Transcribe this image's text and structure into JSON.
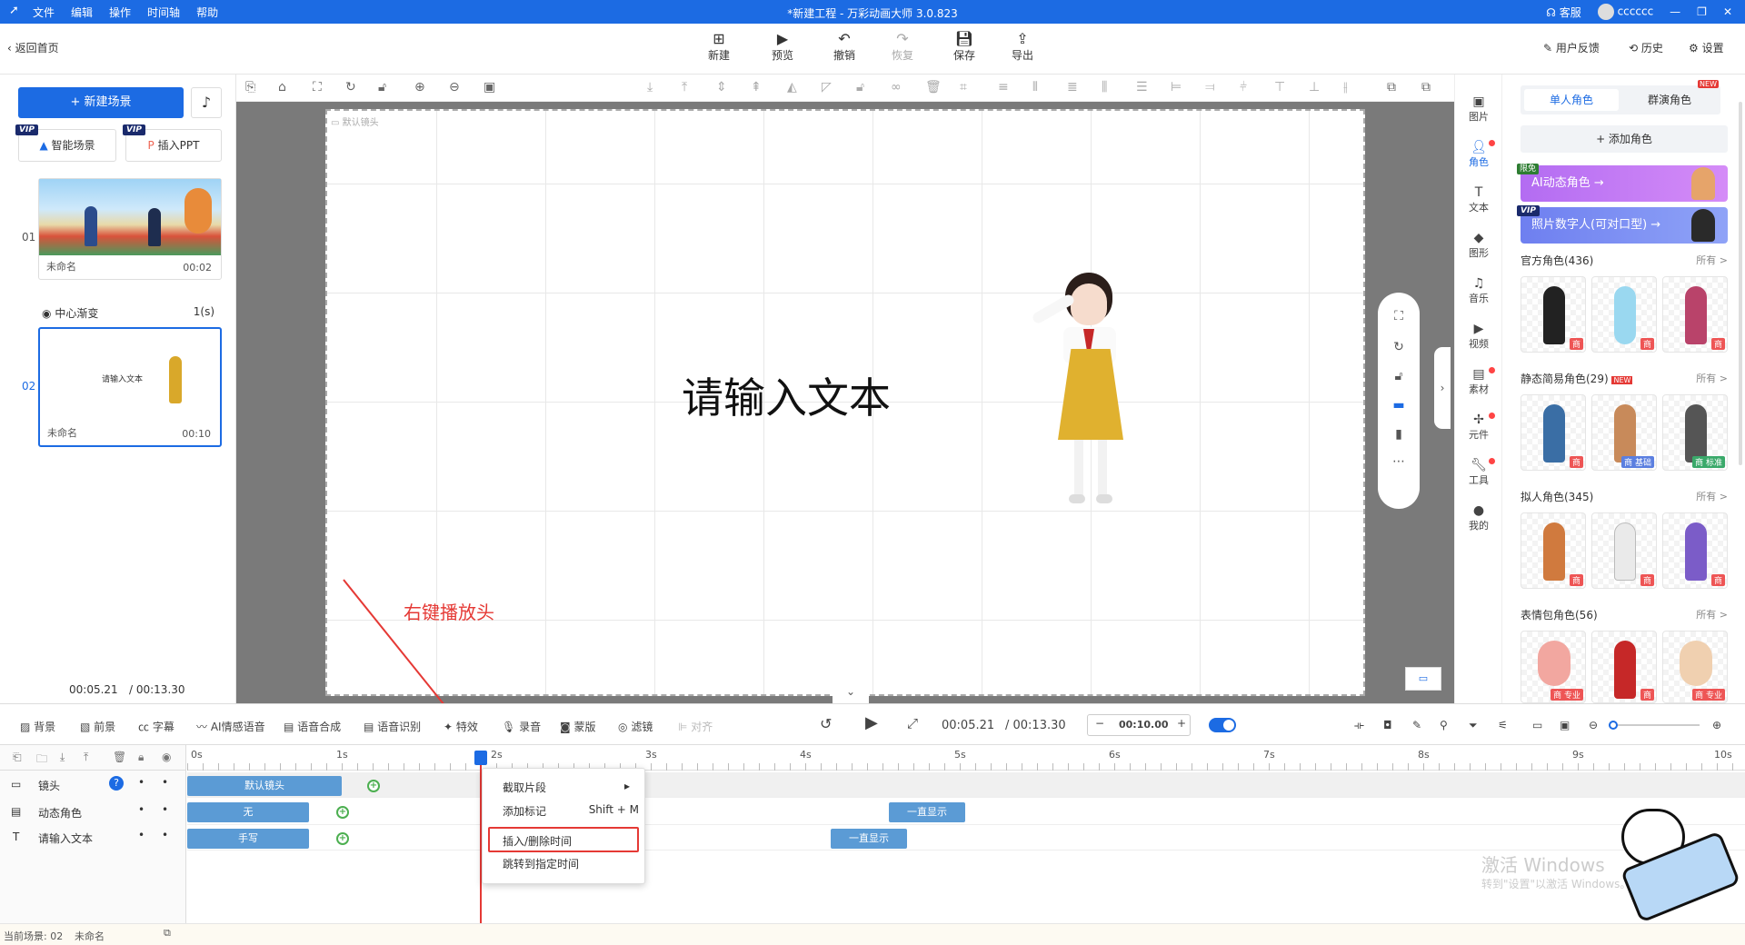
{
  "titlebar": {
    "menu": [
      "文件",
      "编辑",
      "操作",
      "时间轴",
      "帮助"
    ],
    "title": "*新建工程 - 万彩动画大师 3.0.823",
    "service": "客服",
    "user": "cccccc"
  },
  "toolbar": {
    "back": "返回首页",
    "buttons": [
      "新建",
      "预览",
      "撤销",
      "恢复",
      "保存",
      "导出"
    ],
    "feedback": "用户反馈",
    "history": "历史",
    "settings": "设置"
  },
  "left": {
    "new_scene": "+ 新建场景",
    "smart_scene": "智能场景",
    "insert_ppt": "插入PPT",
    "vip": "VIP",
    "scenes": [
      {
        "num": "01",
        "name": "未命名",
        "time": "00:02"
      },
      {
        "num": "02",
        "name": "未命名",
        "time": "00:10",
        "thumb_text": "请输入文本"
      }
    ],
    "transition": {
      "name": "中心渐变",
      "duration": "1(s)"
    },
    "time_current": "00:05.21",
    "time_total": "/ 00:13.30"
  },
  "canvas": {
    "camera_label": "默认镜头",
    "main_text": "请输入文本",
    "annotation": "右键播放头"
  },
  "sidestrip": [
    "图片",
    "角色",
    "文本",
    "图形",
    "音乐",
    "视频",
    "素材",
    "元件",
    "工具",
    "我的"
  ],
  "rightpanel": {
    "tab_single": "单人角色",
    "tab_group": "群演角色",
    "tab_group_badge": "NEW",
    "add_role": "+ 添加角色",
    "ai_banner": "AI动态角色 →",
    "ai_badge": "限免",
    "photo_banner": "照片数字人(可对口型) →",
    "photo_badge": "VIP",
    "sections": [
      {
        "title": "官方角色(436)",
        "more": "所有 >"
      },
      {
        "title": "静态简易角色(29)",
        "more": "所有 >",
        "badge": "NEW"
      },
      {
        "title": "拟人角色(345)",
        "more": "所有 >"
      },
      {
        "title": "表情包角色(56)",
        "more": "所有 >"
      }
    ],
    "tags": [
      "商",
      "商",
      "商",
      "商",
      "商 基础",
      "商 标准",
      "商",
      "商",
      "商",
      "商 专业",
      "商",
      "商 专业"
    ]
  },
  "timeline": {
    "tools": [
      "背景",
      "前景",
      "字幕",
      "AI情感语音",
      "语音合成",
      "语音识别",
      "特效",
      "录音",
      "蒙版",
      "滤镜",
      "对齐"
    ],
    "time_current": "00:05.21",
    "time_total": "/ 00:13.30",
    "zoom_value": "00:10.00",
    "ruler": [
      "0s",
      "1s",
      "2s",
      "3s",
      "4s",
      "5s",
      "6s",
      "7s",
      "8s",
      "9s",
      "10s"
    ],
    "tracks": [
      {
        "name": "镜头",
        "clip": "默认镜头"
      },
      {
        "name": "动态角色",
        "clip": "无",
        "clip2": "一直显示"
      },
      {
        "name": "请输入文本",
        "clip": "手写",
        "clip2": "一直显示"
      }
    ]
  },
  "context_menu": {
    "items": [
      "截取片段",
      "添加标记",
      "插入/删除时间",
      "跳转到指定时间"
    ],
    "shortcut": "Shift + M"
  },
  "status": {
    "current_scene": "当前场景: 02",
    "scene_name": "未命名"
  },
  "watermark": {
    "line1": "激活 Windows",
    "line2": "转到\"设置\"以激活 Windows。"
  },
  "colors": {
    "brand": "#1c6be3",
    "annotation": "#e53935",
    "clip": "#5b9bd5"
  }
}
